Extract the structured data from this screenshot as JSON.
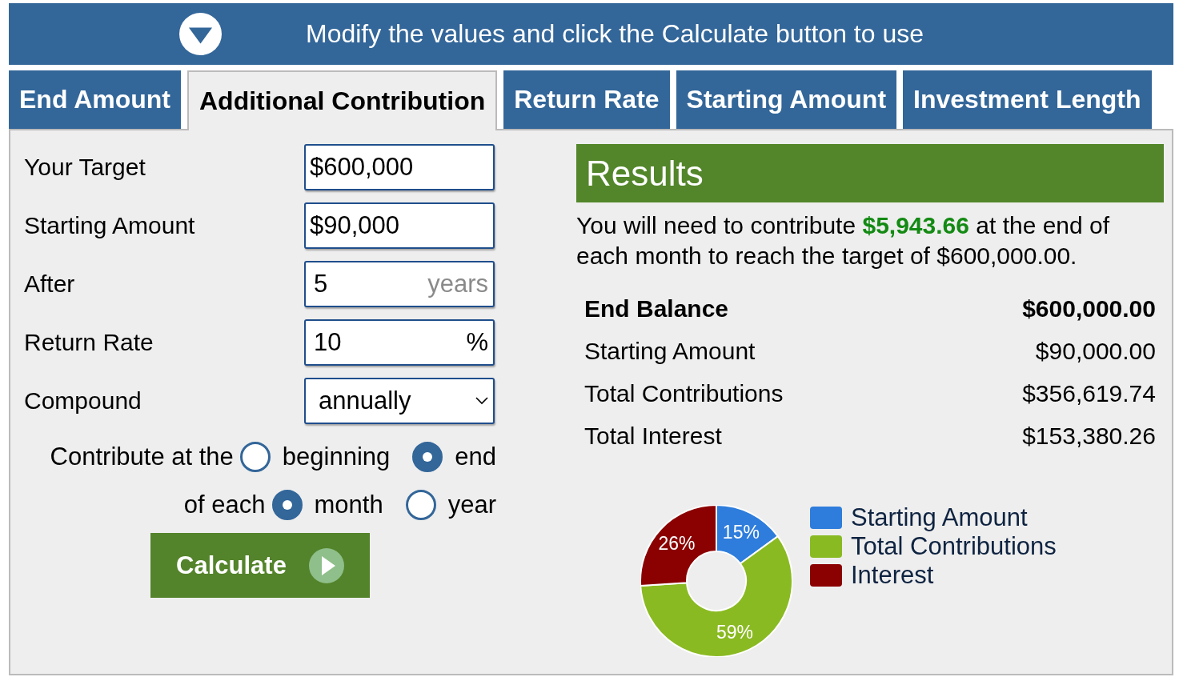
{
  "banner": {
    "text": "Modify the values and click the Calculate button to use"
  },
  "tabs": [
    {
      "label": "End Amount",
      "selected": false
    },
    {
      "label": "Additional Contribution",
      "selected": true
    },
    {
      "label": "Return Rate",
      "selected": false
    },
    {
      "label": "Starting Amount",
      "selected": false
    },
    {
      "label": "Investment Length",
      "selected": false
    }
  ],
  "form": {
    "fields": [
      {
        "label": "Your Target",
        "kind": "text",
        "value": "$600,000"
      },
      {
        "label": "Starting Amount",
        "kind": "text",
        "value": "$90,000"
      },
      {
        "label": "After",
        "kind": "text",
        "value": "5",
        "unit": "years",
        "unit_muted": true
      },
      {
        "label": "Return Rate",
        "kind": "text",
        "value": "10",
        "unit": "%",
        "unit_muted": false
      },
      {
        "label": "Compound",
        "kind": "select",
        "value": "annually"
      }
    ],
    "radio_groups": [
      {
        "label": "Contribute at the",
        "options": [
          {
            "label": "beginning",
            "selected": false
          },
          {
            "label": "end",
            "selected": true
          }
        ]
      },
      {
        "label": "of each",
        "options": [
          {
            "label": "month",
            "selected": true
          },
          {
            "label": "year",
            "selected": false
          }
        ]
      }
    ],
    "calculate_button": "Calculate"
  },
  "results": {
    "title": "Results",
    "summary": "You will need to contribute **$5,943.66** at the end of each month to reach the target of $600,000.00.",
    "rows": [
      {
        "label": "End Balance",
        "value": "$600,000.00",
        "emphasis": true
      },
      {
        "label": "Starting Amount",
        "value": "$90,000.00",
        "emphasis": false
      },
      {
        "label": "Total Contributions",
        "value": "$356,619.74",
        "emphasis": false
      },
      {
        "label": "Total Interest",
        "value": "$153,380.26",
        "emphasis": false
      }
    ],
    "chart_data": {
      "type": "donut",
      "categories": [
        "Starting Amount",
        "Total Contributions",
        "Interest"
      ],
      "series": [
        {
          "values": [
            15,
            59,
            26
          ]
        }
      ],
      "colors": [
        "#2e7ddc",
        "#8aba22",
        "#8b0000"
      ],
      "value_labels": [
        "15%",
        "59%",
        "26%"
      ]
    }
  }
}
